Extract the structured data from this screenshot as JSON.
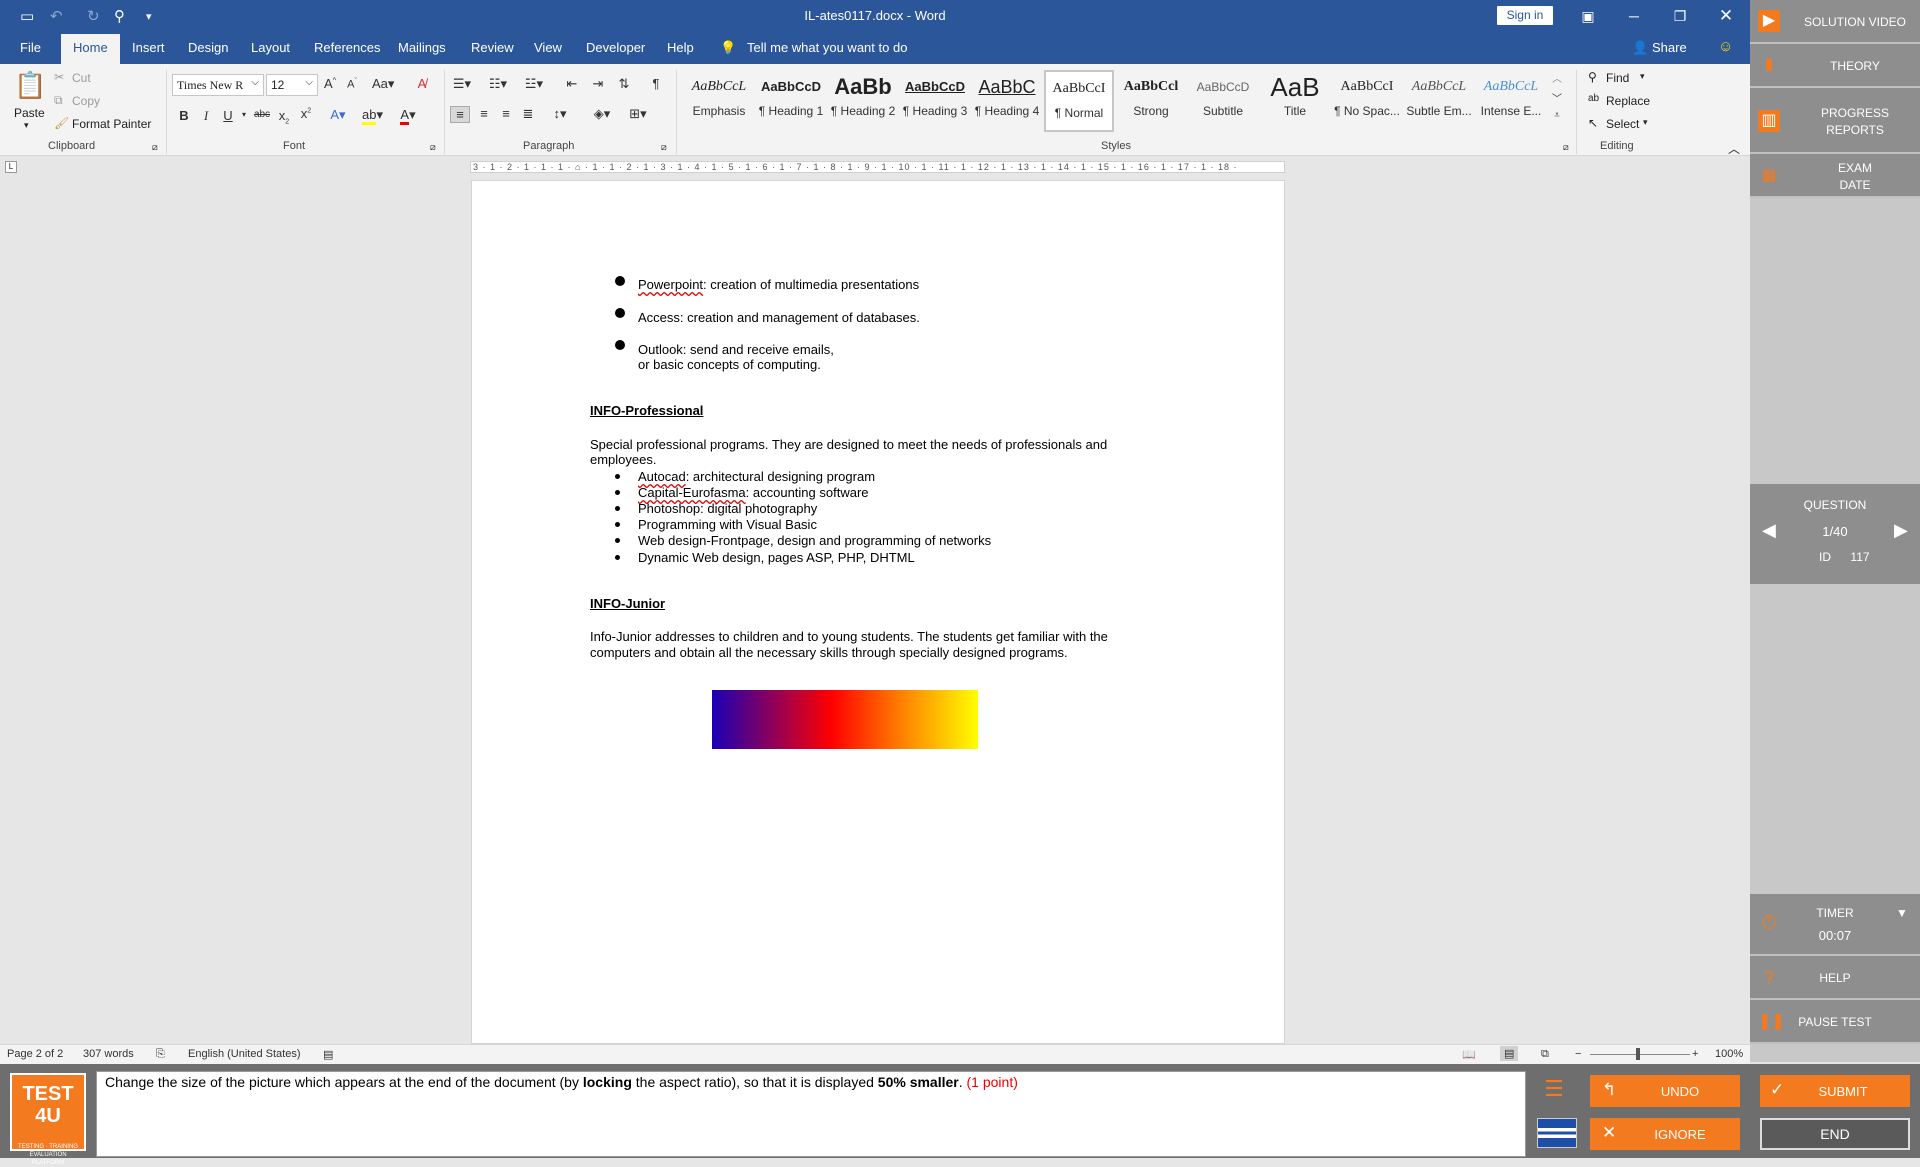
{
  "window": {
    "title": "IL-ates0117.docx - Word",
    "signin_label": "Sign in",
    "share_label": "Share"
  },
  "tabs": [
    "File",
    "Home",
    "Insert",
    "Design",
    "Layout",
    "References",
    "Mailings",
    "Review",
    "View",
    "Developer",
    "Help"
  ],
  "tell_me": "Tell me what you want to do",
  "ribbon": {
    "clipboard": {
      "paste": "Paste",
      "cut": "Cut",
      "copy": "Copy",
      "format_painter": "Format Painter",
      "label": "Clipboard"
    },
    "font": {
      "family": "Times New R",
      "size": "12",
      "label": "Font"
    },
    "paragraph": {
      "label": "Paragraph"
    },
    "styles": {
      "label": "Styles",
      "items": [
        {
          "sample": "AaBbCcL",
          "name": "Emphasis"
        },
        {
          "sample": "AaBbCcD",
          "name": "¶ Heading 1"
        },
        {
          "sample": "AaBb",
          "name": "¶ Heading 2"
        },
        {
          "sample": "AaBbCcD",
          "name": "¶ Heading 3"
        },
        {
          "sample": "AaBbC",
          "name": "¶ Heading 4"
        },
        {
          "sample": "AaBbCcI",
          "name": "¶ Normal"
        },
        {
          "sample": "AaBbCcl",
          "name": "Strong"
        },
        {
          "sample": "AaBbCcD",
          "name": "Subtitle"
        },
        {
          "sample": "AaB",
          "name": "Title"
        },
        {
          "sample": "AaBbCcI",
          "name": "¶ No Spac..."
        },
        {
          "sample": "AaBbCcL",
          "name": "Subtle Em..."
        },
        {
          "sample": "AaBbCcL",
          "name": "Intense E..."
        }
      ]
    },
    "editing": {
      "find": "Find",
      "replace": "Replace",
      "select": "Select",
      "label": "Editing"
    }
  },
  "ruler": "3 · 1 · 2 · 1 · 1 · 1 · ⌂ · 1 · 1 · 2 · 1 · 3 · 1 · 4 · 1 · 5 · 1 · 6 · 1 · 7 · 1 · 8 · 1 · 9 · 1 · 10 · 1 · 11 · 1 · 12 · 1 · 13 · 1 · 14 · 1 · 15 · 1 · 16 · 1 · 17 · 1 · 18 ·",
  "document": {
    "bullets_top": [
      {
        "lead": "Powerpoint",
        "rest": ": creation of multimedia presentations"
      },
      {
        "lead": "",
        "rest": "Access: creation and management of databases."
      },
      {
        "lead": "",
        "rest": "Outlook: send and receive emails,"
      }
    ],
    "bullet3_cont": "or basic concepts of computing.",
    "heading_pro": "INFO-Professional",
    "pro_para_1": "Special professional programs. They are designed to meet the needs of professionals and",
    "pro_para_2": "employees.",
    "pro_bullets": [
      {
        "lead": "Autocad",
        "rest": ": architectural designing program"
      },
      {
        "lead": "Capital-Eurofasma",
        "rest": ": accounting software"
      },
      {
        "lead": "",
        "rest": "Photoshop: digital photography"
      },
      {
        "lead": "",
        "rest": "Programming with Visual Basic"
      },
      {
        "lead": "",
        "rest": "Web design-Frontpage, design and programming of networks"
      },
      {
        "lead": "",
        "rest": "Dynamic Web design, pages ASP, PHP, DHTML"
      }
    ],
    "heading_junior": "INFO-Junior",
    "junior_para_1": "Info-Junior addresses to children and to young students. The students get familiar with the",
    "junior_para_2": "computers and obtain all the necessary skills through specially designed programs."
  },
  "status": {
    "page": "Page 2 of 2",
    "words": "307 words",
    "language": "English (United States)",
    "zoom": "100%"
  },
  "side_panel": {
    "solution_video": "SOLUTION VIDEO",
    "theory": "THEORY",
    "progress_1": "PROGRESS",
    "progress_2": "REPORTS",
    "exam_1": "EXAM",
    "exam_2": "DATE",
    "question_label": "QUESTION",
    "question_num": "1/40",
    "id_label": "ID",
    "id_value": "117",
    "timer_label": "TIMER",
    "timer_value": "00:07",
    "help": "HELP",
    "pause": "PAUSE TEST"
  },
  "bottom": {
    "logo_main": "TEST 4U",
    "logo_sub": "TESTING · TRAINING EVALUATION PLATFORM",
    "q_part1": "Change the size of the picture which appears at the end of the document (by ",
    "q_bold1": "locking",
    "q_part2": " the aspect ratio), so that it is displayed ",
    "q_bold2": "50% smaller",
    "q_part3": ". ",
    "q_points": "(1 point)",
    "undo": "UNDO",
    "ignore": "IGNORE",
    "submit": "SUBMIT",
    "end": "END"
  },
  "colors": {
    "word_blue": "#2b579a",
    "accent_orange": "#f47a20",
    "panel_gray": "#8e8e8e"
  }
}
